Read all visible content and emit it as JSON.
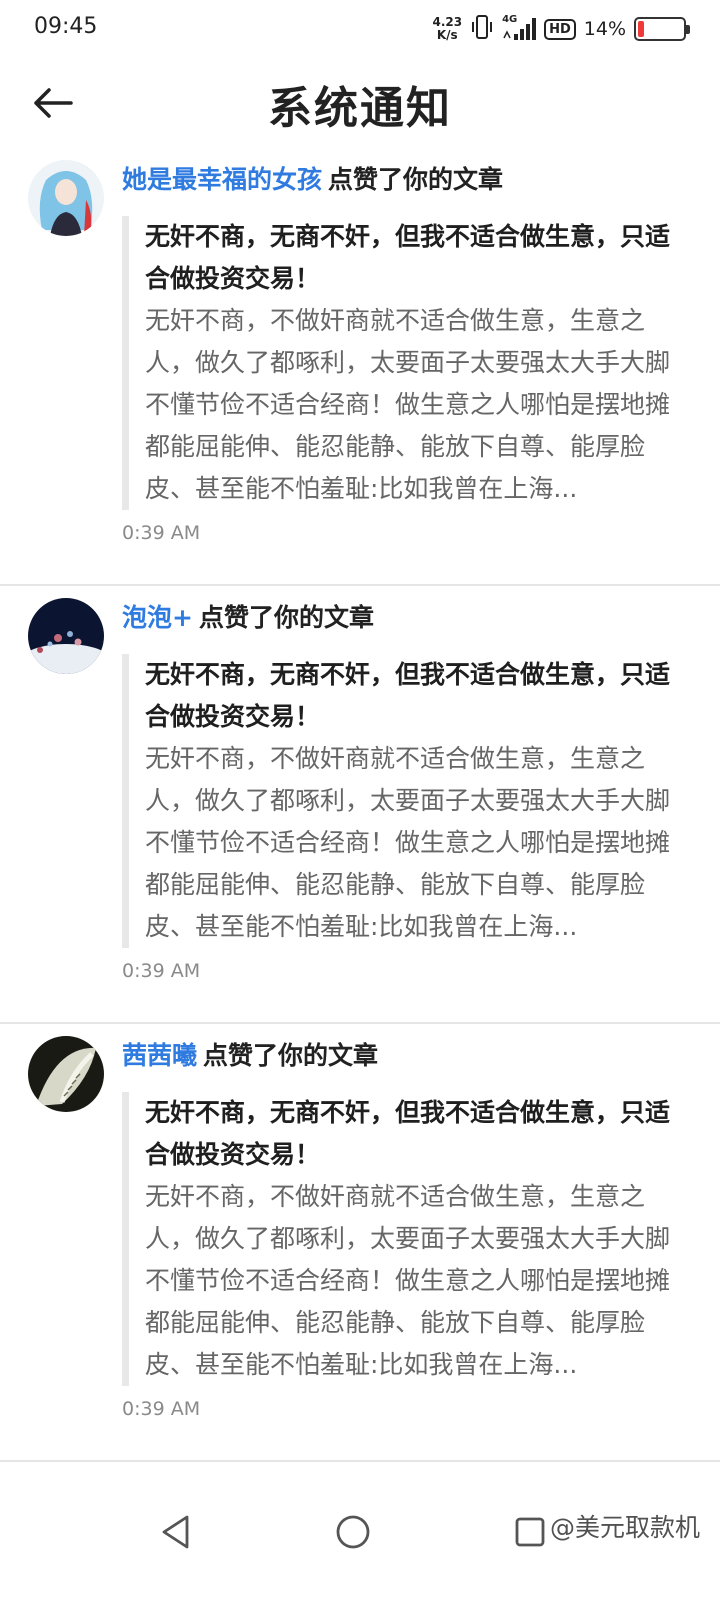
{
  "status_bar": {
    "time": "09:45",
    "net_speed_value": "4.23",
    "net_speed_unit": "K/s",
    "network": "4G",
    "hd": "HD",
    "battery_pct": "14%",
    "battery_level": 0.14
  },
  "header": {
    "title": "系统通知",
    "back_icon": "arrow-left-icon"
  },
  "notifications": [
    {
      "user": "她是最幸福的女孩",
      "action": "点赞了你的文章",
      "article_title": "无奸不商，无商不奸，但我不适合做生意，只适合做投资交易！",
      "article_excerpt": "无奸不商，不做奸商就不适合做生意，生意之人，做久了都啄利，太要面子太要强太大手大脚不懂节俭不适合经商！做生意之人哪怕是摆地摊都能屈能伸、能忍能静、能放下自尊、能厚脸皮、甚至能不怕羞耻:比如我曾在上海...",
      "time": "0:39 AM"
    },
    {
      "user": "泡泡+",
      "action": "点赞了你的文章",
      "article_title": "无奸不商，无商不奸，但我不适合做生意，只适合做投资交易！",
      "article_excerpt": "无奸不商，不做奸商就不适合做生意，生意之人，做久了都啄利，太要面子太要强太大手大脚不懂节俭不适合经商！做生意之人哪怕是摆地摊都能屈能伸、能忍能静、能放下自尊、能厚脸皮、甚至能不怕羞耻:比如我曾在上海...",
      "time": "0:39 AM"
    },
    {
      "user": "茜茜曦",
      "action": "点赞了你的文章",
      "article_title": "无奸不商，无商不奸，但我不适合做生意，只适合做投资交易！",
      "article_excerpt": "无奸不商，不做奸商就不适合做生意，生意之人，做久了都啄利，太要面子太要强太大手大脚不懂节俭不适合经商！做生意之人哪怕是摆地摊都能屈能伸、能忍能静、能放下自尊、能厚脸皮、甚至能不怕羞耻:比如我曾在上海...",
      "time": "0:39 AM"
    }
  ],
  "nav_bar": {
    "back_icon": "triangle-back-icon",
    "home_icon": "circle-home-icon",
    "recents_icon": "square-recents-icon"
  },
  "watermark": "@美元取款机",
  "colors": {
    "accent": "#2f7be0",
    "battery_low": "#f03a3a",
    "quote_bar": "#e8e8e8",
    "muted_text": "#666666"
  }
}
